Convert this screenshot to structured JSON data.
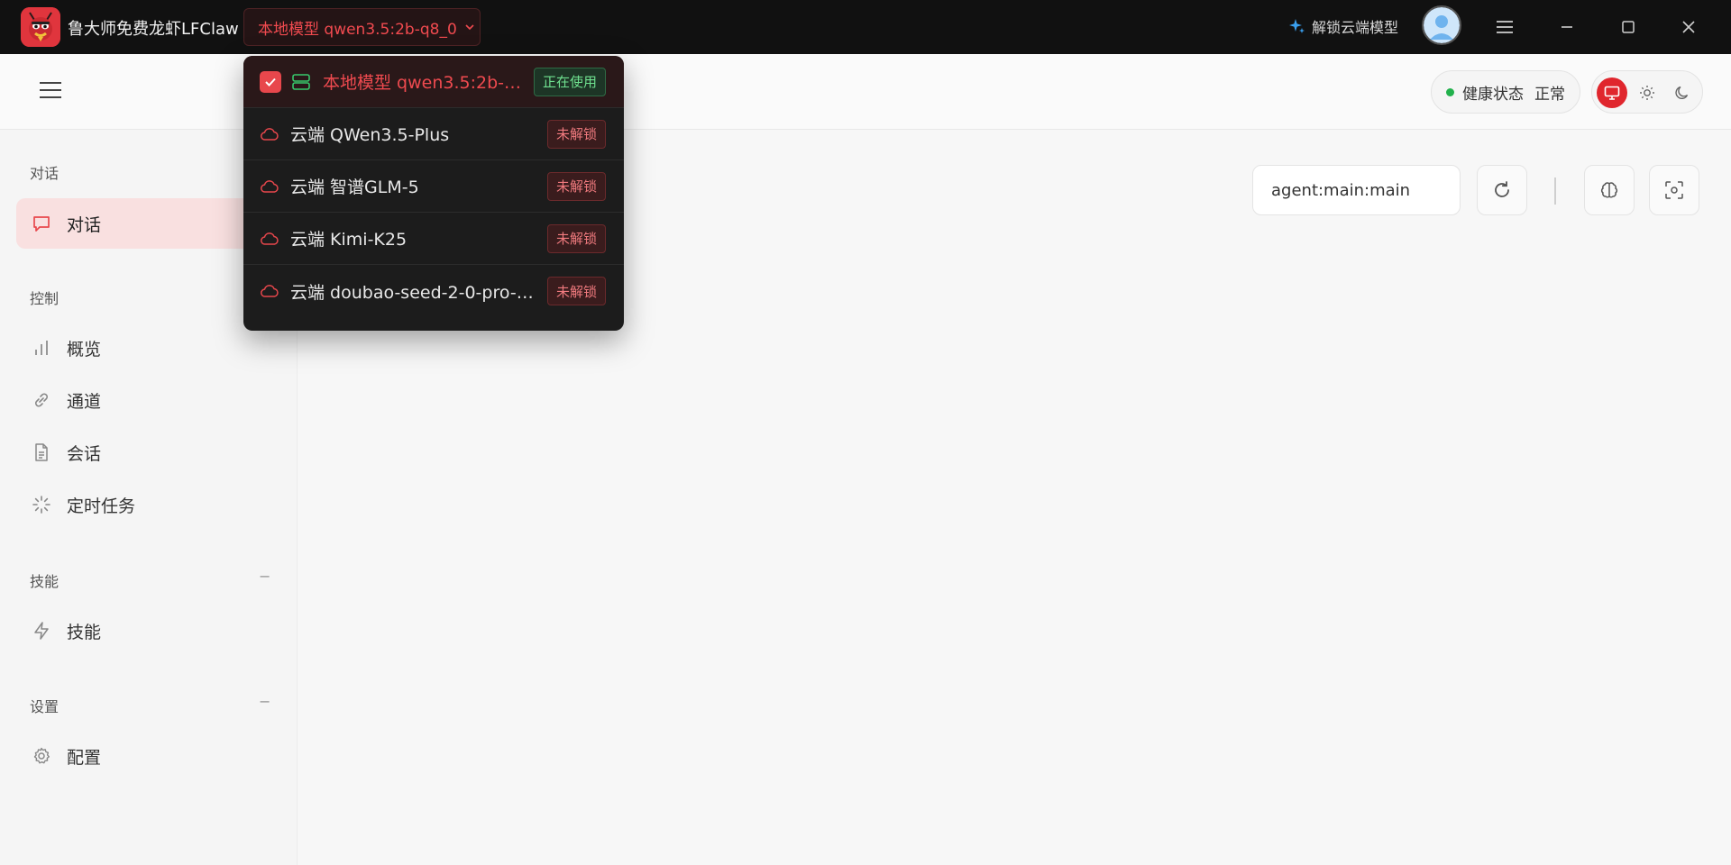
{
  "app": {
    "title": "鲁大师免费龙虾LFClaw",
    "current_model": "本地模型 qwen3.5:2b-q8_0",
    "unlock_label": "解锁云端模型",
    "colors": {
      "accent": "#e8474c",
      "titlebar": "#111111",
      "healthy": "#22b14c"
    }
  },
  "header": {
    "health_label": "健康状态",
    "health_value": "正常",
    "theme_options": [
      "monitor-icon",
      "sun-icon",
      "moon-icon"
    ]
  },
  "sidebar": {
    "sections": {
      "chat": "对话",
      "control": "控制",
      "skills": "技能",
      "settings": "设置"
    },
    "collapse_symbol": "−",
    "items": {
      "chat": "对话",
      "overview": "概览",
      "channels": "通道",
      "sessions": "会话",
      "scheduled": "定时任务",
      "skills": "技能",
      "config": "配置"
    }
  },
  "main": {
    "session_key": "agent:main:main"
  },
  "dropdown": {
    "items": [
      {
        "label": "本地模型 qwen3.5:2b-q8...",
        "badge": "正在使用",
        "type": "local",
        "selected": true
      },
      {
        "label": "云端 QWen3.5-Plus",
        "badge": "未解锁",
        "type": "cloud",
        "selected": false
      },
      {
        "label": "云端 智谱GLM-5",
        "badge": "未解锁",
        "type": "cloud",
        "selected": false
      },
      {
        "label": "云端 Kimi-K25",
        "badge": "未解锁",
        "type": "cloud",
        "selected": false
      },
      {
        "label": "云端 doubao-seed-2-0-pro-2...",
        "badge": "未解锁",
        "type": "cloud",
        "selected": false
      }
    ]
  }
}
